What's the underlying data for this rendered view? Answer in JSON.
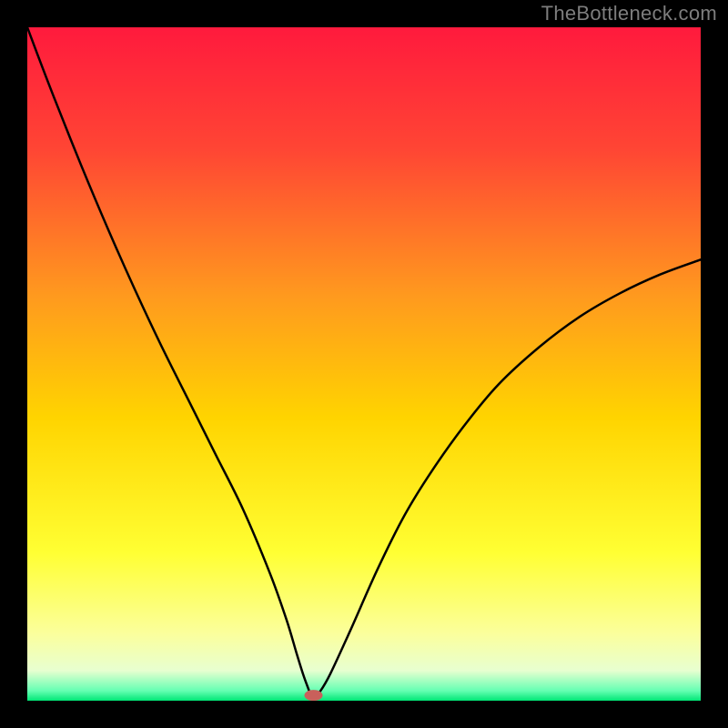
{
  "branding": {
    "watermark": "TheBottleneck.com"
  },
  "chart_data": {
    "type": "line",
    "title": "",
    "xlabel": "",
    "ylabel": "",
    "xlim": [
      0,
      100
    ],
    "ylim": [
      0,
      100
    ],
    "grid": false,
    "legend": false,
    "background_gradient_stops": [
      {
        "offset": 0.0,
        "color": "#ff1a3d"
      },
      {
        "offset": 0.18,
        "color": "#ff4534"
      },
      {
        "offset": 0.4,
        "color": "#ff9a1e"
      },
      {
        "offset": 0.58,
        "color": "#ffd400"
      },
      {
        "offset": 0.78,
        "color": "#ffff33"
      },
      {
        "offset": 0.9,
        "color": "#fbff9c"
      },
      {
        "offset": 0.955,
        "color": "#e8ffd0"
      },
      {
        "offset": 0.985,
        "color": "#66ffb3"
      },
      {
        "offset": 1.0,
        "color": "#00e676"
      }
    ],
    "series": [
      {
        "name": "bottleneck-curve",
        "color": "#000000",
        "width": 2.5,
        "x": [
          0,
          1.5,
          4,
          8,
          12,
          16,
          20,
          24,
          28,
          32,
          36,
          38.5,
          40,
          41,
          41.8,
          42.2,
          42.6,
          43.5,
          45,
          48,
          52,
          56,
          60,
          65,
          70,
          76,
          82,
          88,
          94,
          100
        ],
        "y": [
          100,
          96,
          89.5,
          79.5,
          70,
          61,
          52.5,
          44.5,
          36.5,
          28.5,
          19,
          12,
          7,
          3.8,
          1.6,
          0.5,
          0.5,
          1.4,
          4,
          10.5,
          19.5,
          27.5,
          34,
          41,
          47,
          52.5,
          57,
          60.5,
          63.3,
          65.5
        ]
      }
    ],
    "markers": [
      {
        "name": "optimal-point",
        "x": 42.5,
        "y": 0.8,
        "color": "#c9605b",
        "rx": 10,
        "ry": 6
      }
    ]
  }
}
